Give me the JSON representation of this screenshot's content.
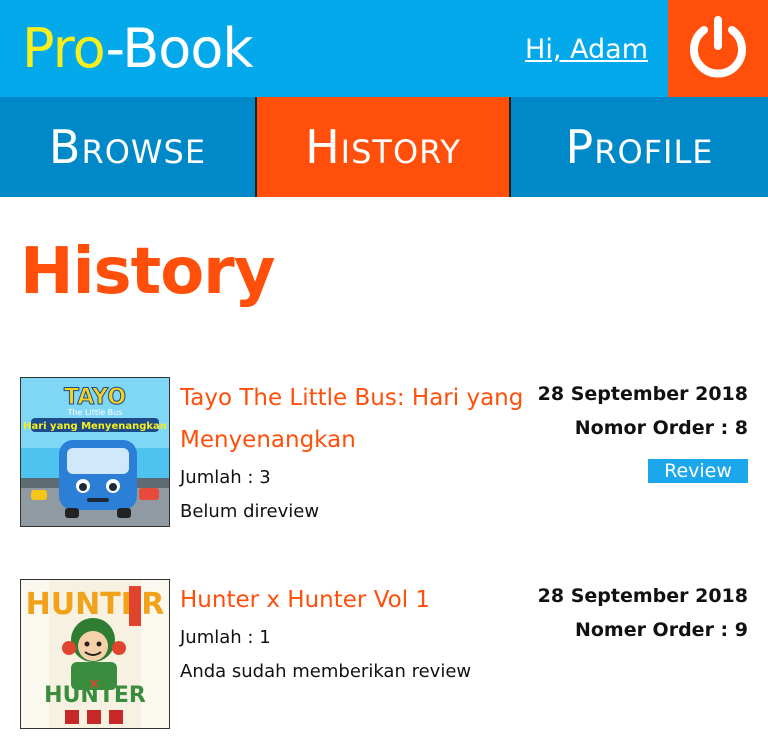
{
  "header": {
    "logo_part1": "Pro",
    "logo_part2": "-Book",
    "greeting": "Hi, Adam",
    "logout_icon": "power-icon"
  },
  "nav": {
    "tabs": [
      {
        "label": "Browse",
        "active": false
      },
      {
        "label": "History",
        "active": true
      },
      {
        "label": "Profile",
        "active": false
      }
    ]
  },
  "page": {
    "title": "History"
  },
  "orders": [
    {
      "title": "Tayo The Little Bus: Hari yang Menyenangkan",
      "quantity": "Jumlah : 3",
      "review_status": "Belum direview",
      "date": "28 September 2018",
      "order_number": "Nomor Order : 8",
      "review_button": "Review",
      "cover_text_1": "TAYO",
      "cover_text_2": "The Little Bus",
      "cover_text_3": "Hari yang Menyenangkan"
    },
    {
      "title": "Hunter x Hunter Vol 1",
      "quantity": "Jumlah : 1",
      "review_status": "Anda sudah memberikan review",
      "date": "28 September 2018",
      "order_number": "Nomer Order : 9",
      "cover_text_1": "HUNTER",
      "cover_text_2": "HUNTER"
    }
  ],
  "colors": {
    "header_bg": "#03a9ea",
    "nav_bg": "#0089c9",
    "accent": "#ff4f0a",
    "logo_yellow": "#f7ee1d",
    "button_blue": "#1aa7ec"
  }
}
